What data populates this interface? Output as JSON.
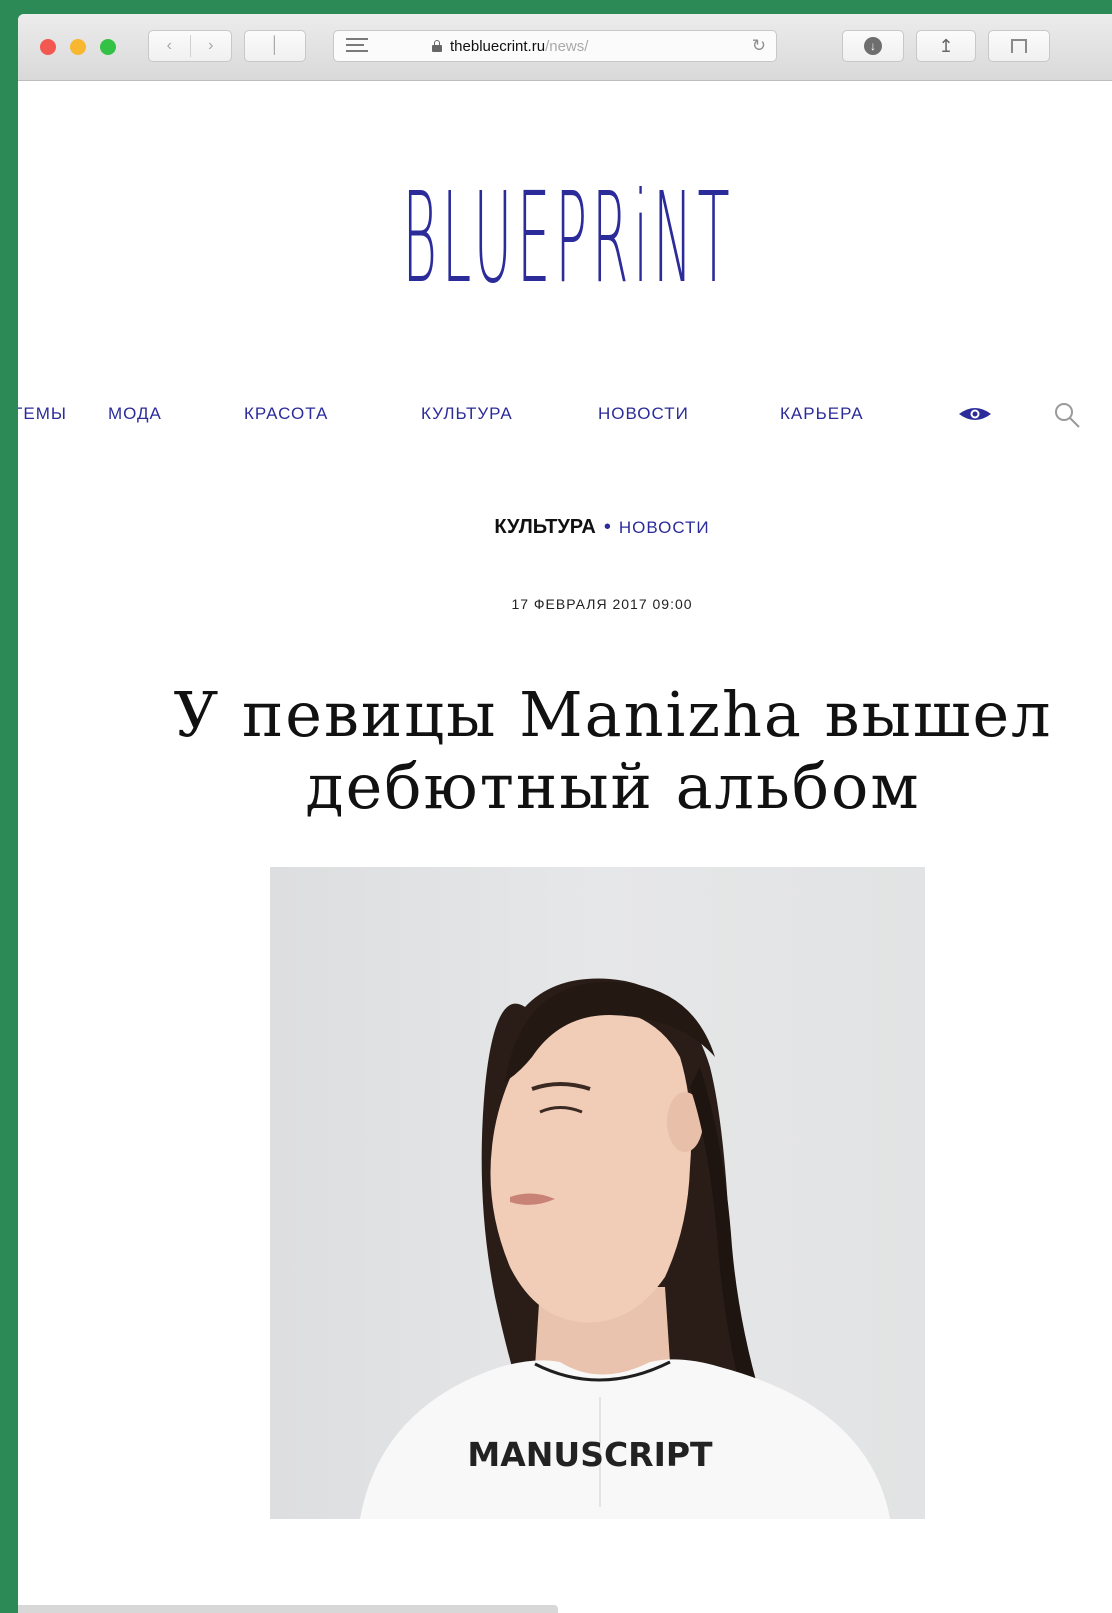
{
  "browser": {
    "url_host": "thebluecrint.ru",
    "url_path": "/news/"
  },
  "site": {
    "logo": "BLUEPRiNT",
    "nav": [
      "ТЕМЫ",
      "МОДА",
      "КРАСОТА",
      "КУЛЬТУРА",
      "НОВОСТИ",
      "КАРЬЕРА"
    ]
  },
  "article": {
    "category": "КУЛЬТУРА",
    "separator": "•",
    "subcategory": "НОВОСТИ",
    "date": "17 ФЕВРАЛЯ 2017 09:00",
    "title_line1": "У певицы Manizha вышел",
    "title_line2": "дебютный альбом",
    "image_caption": "MANUSCRIPT"
  },
  "colors": {
    "brand": "#2b2c9a",
    "desktop": "#2c8a57"
  },
  "icons": [
    "reader-icon",
    "lock-icon",
    "reload-icon",
    "download-icon",
    "share-icon",
    "tabs-icon",
    "eye-icon",
    "search-icon"
  ]
}
